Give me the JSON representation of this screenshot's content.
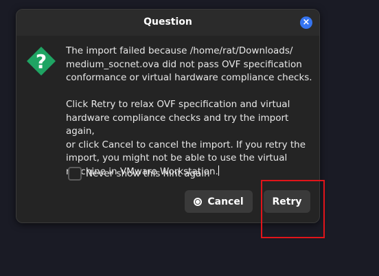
{
  "window": {
    "title": "Question",
    "close_label": "×"
  },
  "message": {
    "paragraph1": "The import failed because /home/rat/Downloads/\nmedium_socnet.ova did not pass OVF specification\nconformance or virtual hardware compliance checks.",
    "paragraph2": "Click Retry to relax OVF specification and virtual\nhardware compliance checks and try the import again,\nor click Cancel to cancel the import. If you retry the\nimport, you might not be able to use the virtual\nmachine in VMware Workstation."
  },
  "icon": {
    "name": "question-icon",
    "glyph": "?",
    "color": "#1fa463"
  },
  "checkbox": {
    "label": "Never show this hint again",
    "checked": false
  },
  "buttons": {
    "cancel_label": "Cancel",
    "retry_label": "Retry"
  },
  "colors": {
    "accent_close": "#3574f0",
    "highlight": "#e2141a"
  }
}
